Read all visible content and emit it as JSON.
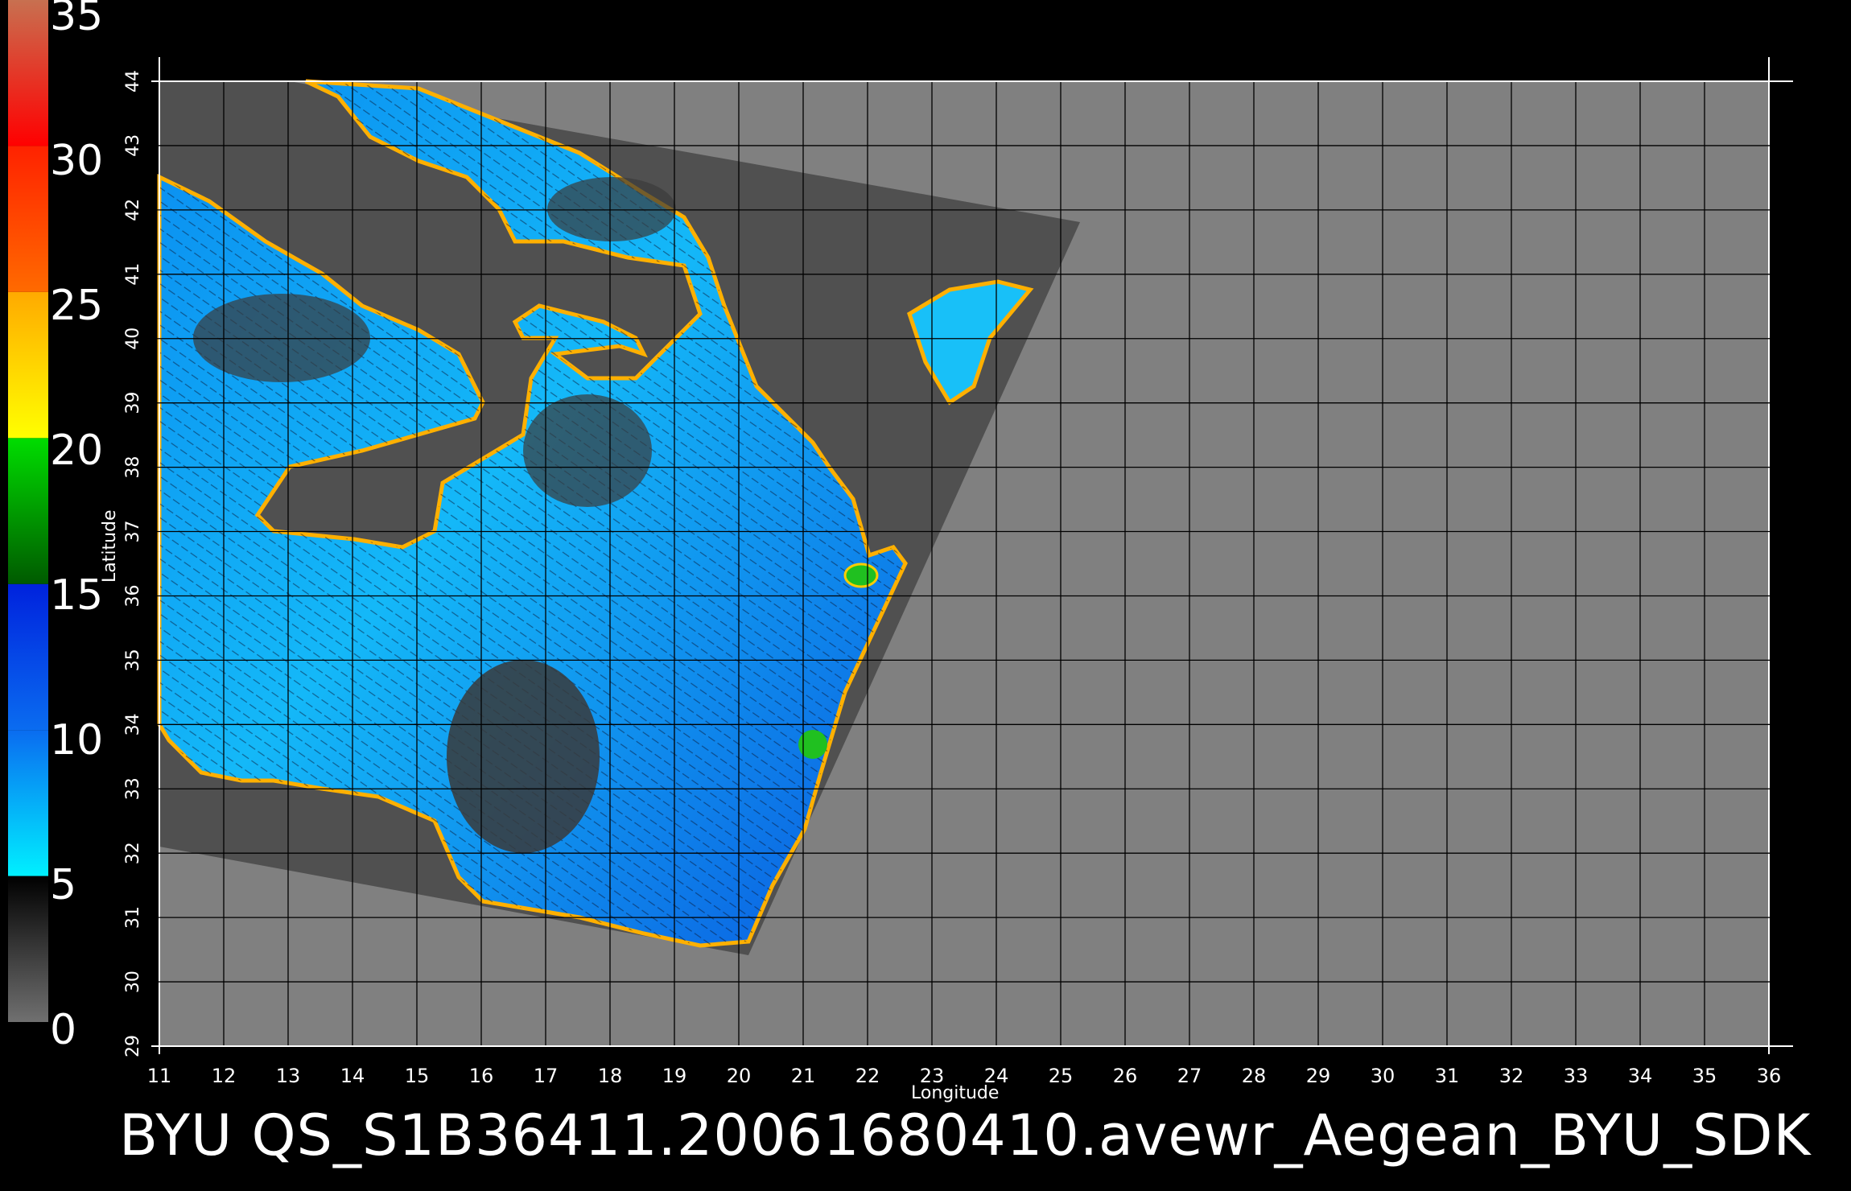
{
  "colorbar": {
    "labels": [
      "35",
      "30",
      "25",
      "20",
      "15",
      "10",
      "5",
      "0"
    ],
    "segments": [
      {
        "from": 0,
        "to": 5,
        "color_top": "#000000",
        "color_bottom": "#707070"
      },
      {
        "from": 5,
        "to": 10,
        "color_top": "#0a6cf0",
        "color_bottom": "#00f0ff"
      },
      {
        "from": 10,
        "to": 15,
        "color_top": "#0022dd",
        "color_bottom": "#0a6cf0"
      },
      {
        "from": 15,
        "to": 20,
        "color_top": "#00dd00",
        "color_bottom": "#005a00"
      },
      {
        "from": 20,
        "to": 25,
        "color_top": "#ffaa00",
        "color_bottom": "#ffff00"
      },
      {
        "from": 25,
        "to": 30,
        "color_top": "#ff2200",
        "color_bottom": "#ff6a00"
      },
      {
        "from": 30,
        "to": 35,
        "color_top": "#c87050",
        "color_bottom": "#ff0000"
      }
    ]
  },
  "map": {
    "lon_ticks": [
      "11",
      "12",
      "13",
      "14",
      "15",
      "16",
      "17",
      "18",
      "19",
      "20",
      "21",
      "22",
      "23",
      "24",
      "25",
      "26",
      "27",
      "28",
      "29",
      "30",
      "31",
      "32",
      "33",
      "34",
      "35",
      "36"
    ],
    "lat_ticks": [
      "29",
      "30",
      "31",
      "32",
      "33",
      "34",
      "35",
      "36",
      "37",
      "38",
      "39",
      "40",
      "41",
      "42",
      "43",
      "44"
    ],
    "xlabel": "Longitude",
    "ylabel": "Latitude",
    "background_color": "#808080",
    "swath_color": "#505050"
  },
  "caption": "BYU  QS_S1B36411.20061680410.avewr_Aegean_BYU_SDK"
}
